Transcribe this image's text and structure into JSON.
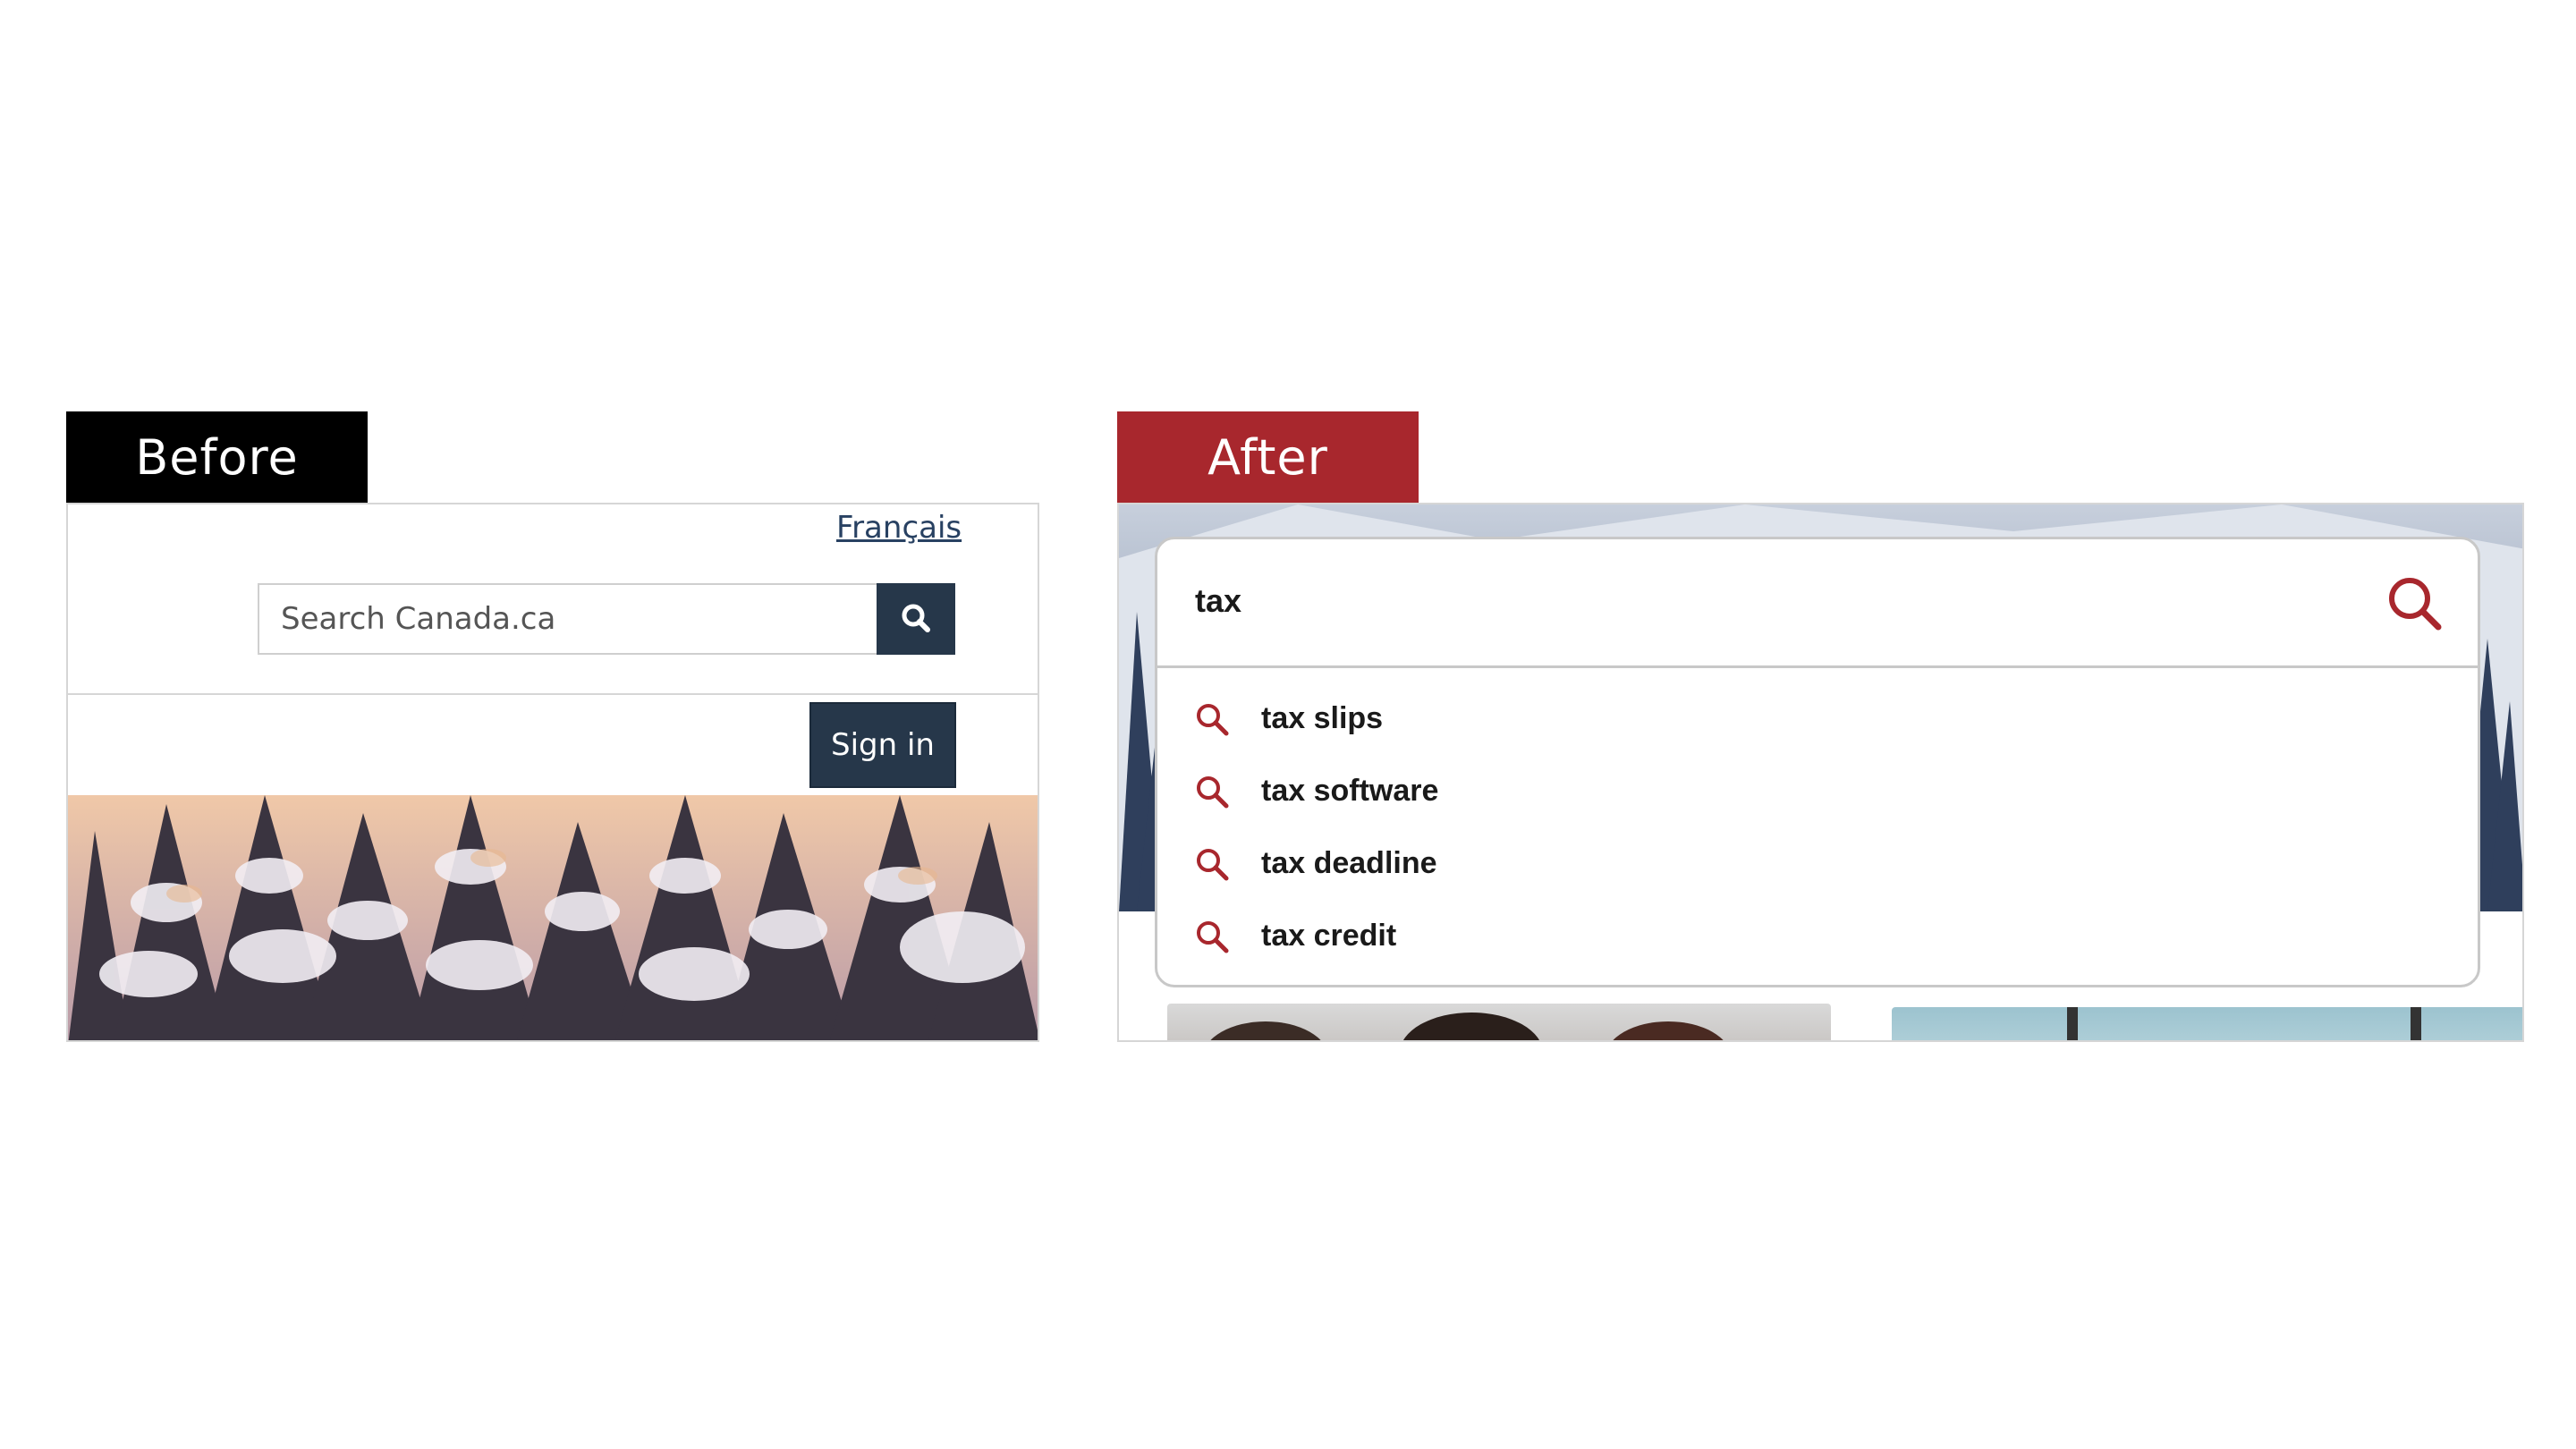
{
  "labels": {
    "before": "Before",
    "after": "After"
  },
  "before": {
    "language_link": "Français",
    "search": {
      "placeholder": "Search Canada.ca",
      "icon": "search-icon"
    },
    "signin_label": "Sign in",
    "colors": {
      "button_bg": "#26374a",
      "link": "#284162"
    }
  },
  "after": {
    "search": {
      "value": "tax",
      "icon": "search-icon"
    },
    "suggestions": [
      {
        "label": "tax slips",
        "icon": "search-icon"
      },
      {
        "label": "tax software",
        "icon": "search-icon"
      },
      {
        "label": "tax deadline",
        "icon": "search-icon"
      },
      {
        "label": "tax credit",
        "icon": "search-icon"
      }
    ],
    "colors": {
      "accent": "#a8272d",
      "icon": "#a8272d"
    }
  }
}
